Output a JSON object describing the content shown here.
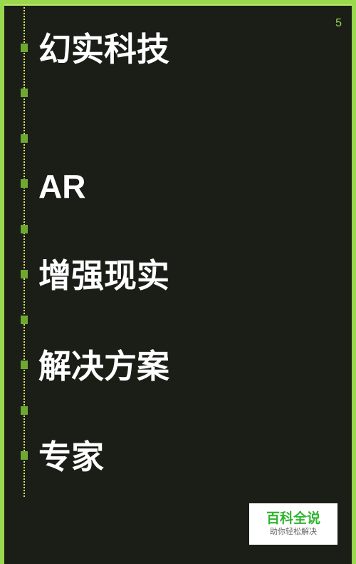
{
  "page_number": "5",
  "items": [
    {
      "text": "幻实科技"
    },
    {
      "text": ""
    },
    {
      "text": ""
    },
    {
      "text": "AR"
    },
    {
      "text": ""
    },
    {
      "text": "增强现实"
    },
    {
      "text": ""
    },
    {
      "text": "解决方案"
    },
    {
      "text": ""
    },
    {
      "text": "专家"
    }
  ],
  "watermark": {
    "title": "百科全说",
    "subtitle": "助你轻松解决"
  },
  "colors": {
    "background": "#1b1d17",
    "border": "#9ad84e",
    "marker": "#6ea832",
    "dotted_line": "#d8e25a",
    "text": "#ffffff",
    "watermark_title": "#2fb52f"
  }
}
